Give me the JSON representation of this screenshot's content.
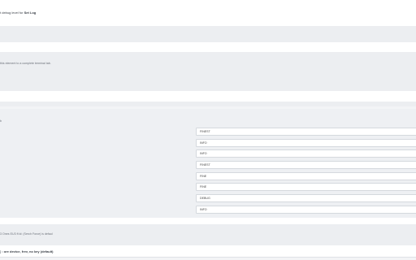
{
  "header": {
    "prefix": "t debug level for ",
    "highlight": "Set Log"
  },
  "section_terminal": {
    "text": "this element to a complete terminal tab."
  },
  "section_levels": {
    "label": "b",
    "rows": [
      "FINEST",
      "INFO",
      "INFO",
      "FINEST",
      "FINE",
      "FINE",
      "DEBUG",
      "INFO"
    ]
  },
  "section_footer": {
    "note": "3 Ones EU3 ft id: (Serch Force) is defaul",
    "option_prefix": "[ ",
    "option_text": ": ore device, frev, no key (default)"
  }
}
